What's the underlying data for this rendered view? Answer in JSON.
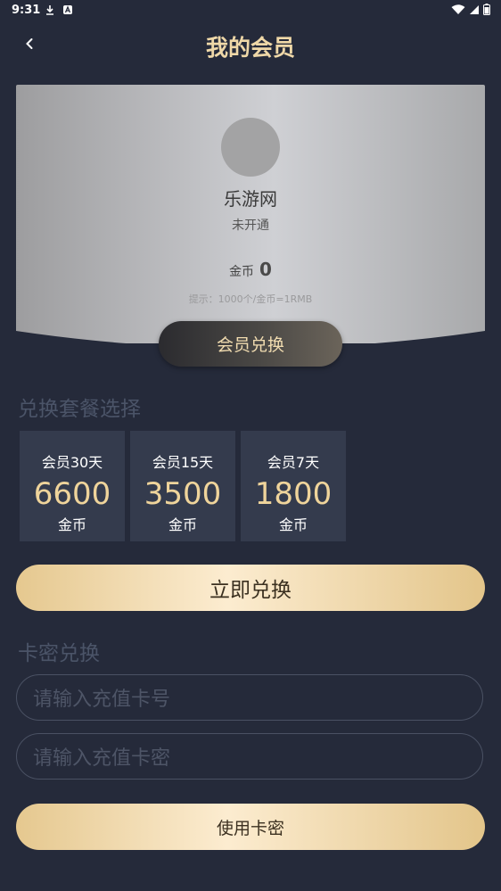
{
  "status_bar": {
    "time": "9:31",
    "left_icons": [
      "download-icon",
      "a-icon"
    ],
    "right_icons": [
      "wifi-icon",
      "signal-icon",
      "battery-icon"
    ]
  },
  "header": {
    "title": "我的会员"
  },
  "member_card": {
    "username": "乐游网",
    "status": "未开通",
    "coins_label": "金币",
    "coins_value": "0",
    "hint": "提示：1000个/金币=1RMB",
    "exchange_button": "会员兑换"
  },
  "packages_section": {
    "title": "兑换套餐选择",
    "packages": [
      {
        "name": "会员30天",
        "price": "6600",
        "unit": "金币"
      },
      {
        "name": "会员15天",
        "price": "3500",
        "unit": "金币"
      },
      {
        "name": "会员7天",
        "price": "1800",
        "unit": "金币"
      }
    ],
    "redeem_button": "立即兑换"
  },
  "card_key_section": {
    "title": "卡密兑换",
    "card_number_placeholder": "请输入充值卡号",
    "card_password_placeholder": "请输入充值卡密",
    "use_button": "使用卡密"
  },
  "colors": {
    "background": "#252a3a",
    "accent_gold": "#efd49b",
    "package_bg": "#343b4d"
  }
}
